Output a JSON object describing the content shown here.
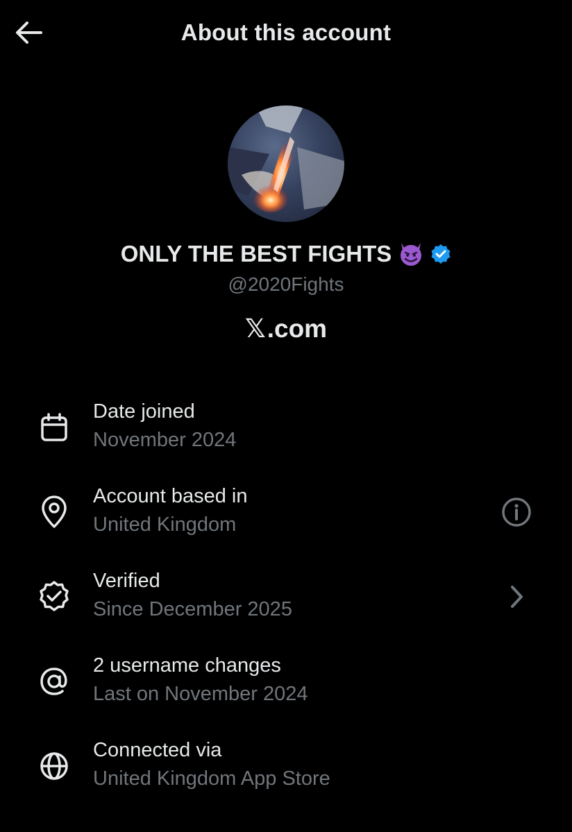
{
  "header": {
    "title": "About this account",
    "back_icon": "arrow-left-icon"
  },
  "profile": {
    "name": "ONLY THE BEST FIGHTS",
    "name_emoji": "😈",
    "verified_icon": "verified-badge-icon",
    "handle": "@2020Fights",
    "platform_logo": "𝕏",
    "platform_suffix": ".com"
  },
  "colors": {
    "background": "#000000",
    "primary_text": "#e7e9ea",
    "secondary_text": "#71767b",
    "verified_blue": "#1d9bf0",
    "emoji_purple": "#9b59d0"
  },
  "info_rows": [
    {
      "icon": "calendar-icon",
      "label": "Date joined",
      "value": "November 2024",
      "action_icon": ""
    },
    {
      "icon": "location-pin-icon",
      "label": "Account based in",
      "value": "United Kingdom",
      "action_icon": "info-icon"
    },
    {
      "icon": "verified-check-icon",
      "label": "Verified",
      "value": "Since December 2025",
      "action_icon": "chevron-right-icon"
    },
    {
      "icon": "at-sign-icon",
      "label": "2 username changes",
      "value": "Last on November 2024",
      "action_icon": ""
    },
    {
      "icon": "globe-icon",
      "label": "Connected via",
      "value": "United Kingdom App Store",
      "action_icon": ""
    }
  ]
}
